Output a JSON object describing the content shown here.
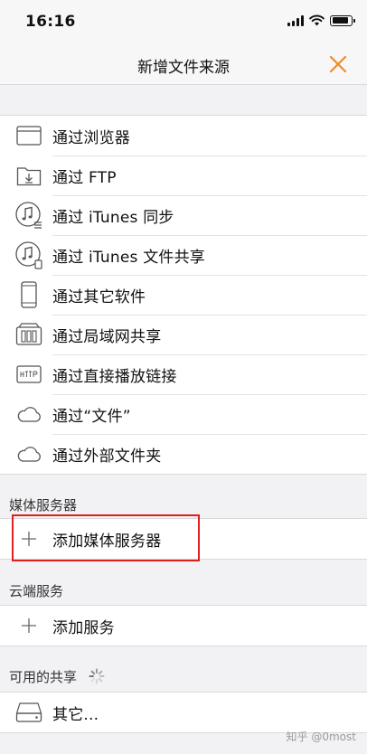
{
  "status_bar": {
    "time": "16:16",
    "battery_level": 0.85
  },
  "nav": {
    "title": "新增文件来源",
    "close_icon": "close-x-icon",
    "accent_color": "#f08a24"
  },
  "sources": [
    {
      "label": "通过浏览器",
      "icon": "browser-window-icon"
    },
    {
      "label": "通过 FTP",
      "icon": "ftp-download-folder-icon"
    },
    {
      "label": "通过 iTunes 同步",
      "icon": "itunes-sync-icon"
    },
    {
      "label": "通过 iTunes 文件共享",
      "icon": "itunes-file-sharing-icon"
    },
    {
      "label": "通过其它软件",
      "icon": "phone-device-icon"
    },
    {
      "label": "通过局域网共享",
      "icon": "network-storage-icon"
    },
    {
      "label": "通过直接播放链接",
      "icon": "http-link-icon"
    },
    {
      "label": "通过“文件”",
      "icon": "cloud-icon"
    },
    {
      "label": "通过外部文件夹",
      "icon": "cloud-icon"
    }
  ],
  "media_server": {
    "header": "媒体服务器",
    "add_label": "添加媒体服务器"
  },
  "cloud_services": {
    "header": "云端服务",
    "add_label": "添加服务"
  },
  "available_shares": {
    "header": "可用的共享",
    "other_label": "其它..."
  },
  "watermark": "知乎 @0most"
}
